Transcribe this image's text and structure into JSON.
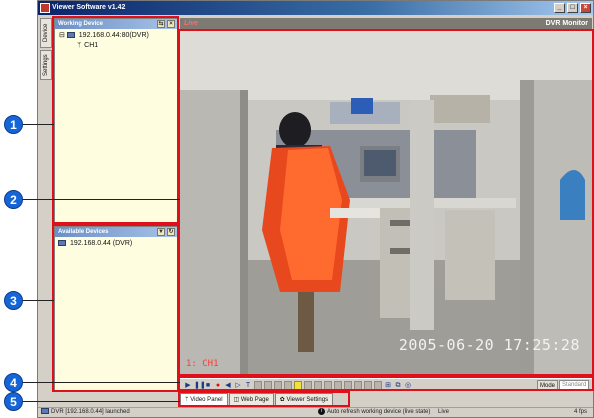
{
  "window": {
    "title": "Viewer Software v1.42",
    "controls": [
      "_",
      "□",
      "×"
    ]
  },
  "side_tabs": [
    "Device",
    "Settings"
  ],
  "working_device": {
    "header": "Working Device",
    "tree": {
      "host": "192.168.0.44:80(DVR)",
      "channel": "CH1"
    }
  },
  "available_devices": {
    "header": "Available Devices",
    "items": [
      "192.168.0.44 (DVR)"
    ]
  },
  "monitor": {
    "mode_label": "Live",
    "title": "DVR Monitor"
  },
  "video": {
    "channel_label": "1: CH1",
    "timestamp": "2005-06-20 17:25:28"
  },
  "toolbar": {
    "mode_label": "Mode",
    "mode_value": "Standard"
  },
  "bottom_tabs": [
    "Video Panel",
    "Web Page",
    "Viewer Settings"
  ],
  "statusbar": {
    "left": "DVR [192.168.0.44] launched",
    "middle": "Auto refresh working device (live state)",
    "middle_right": "Live",
    "right": "4 fps"
  },
  "callouts": [
    "1",
    "2",
    "3",
    "4",
    "5"
  ],
  "colors": {
    "highlight": "#e0101a",
    "callout_fill": "#1565d8",
    "panel_bg": "#fffde0"
  }
}
